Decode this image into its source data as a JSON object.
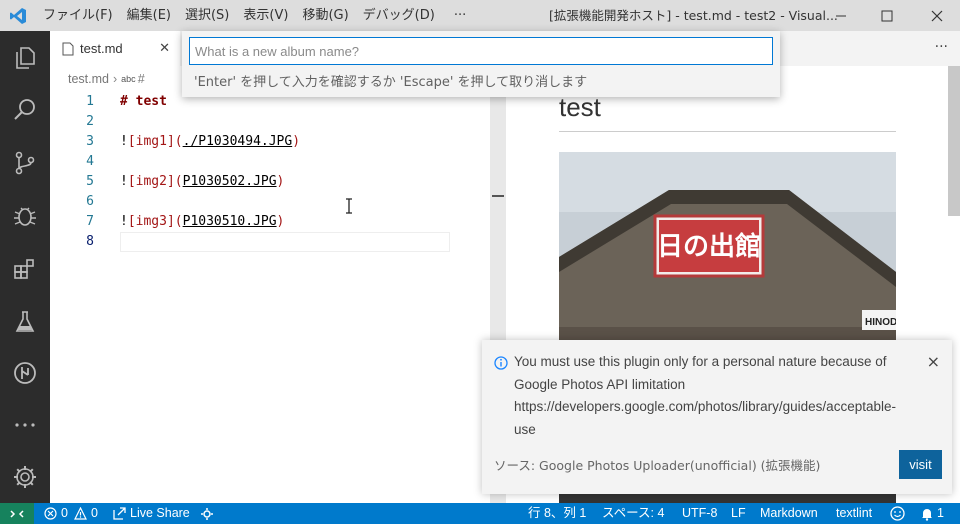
{
  "window": {
    "title": "[拡張機能開発ホスト] - test.md - test2 - Visual...",
    "menu": [
      "ファイル(F)",
      "編集(E)",
      "選択(S)",
      "表示(V)",
      "移動(G)",
      "デバッグ(D)",
      "···"
    ]
  },
  "tabs": {
    "active_label": "test.md",
    "more_actions": "···"
  },
  "breadcrumb": {
    "file": "test.md",
    "symbol_prefix": "abc",
    "symbol": "#"
  },
  "editor": {
    "lines": [
      {
        "num": "1",
        "parts": [
          {
            "t": "# test",
            "c": "heading"
          }
        ]
      },
      {
        "num": "2",
        "parts": []
      },
      {
        "num": "3",
        "parts": [
          {
            "t": "!",
            "c": "bang"
          },
          {
            "t": "[",
            "c": "brk"
          },
          {
            "t": "img1",
            "c": "alt"
          },
          {
            "t": "](",
            "c": "paren"
          },
          {
            "t": "./P1030494.JPG",
            "c": "url-txt"
          },
          {
            "t": ")",
            "c": "paren"
          }
        ]
      },
      {
        "num": "4",
        "parts": []
      },
      {
        "num": "5",
        "parts": [
          {
            "t": "!",
            "c": "bang"
          },
          {
            "t": "[",
            "c": "brk"
          },
          {
            "t": "img2",
            "c": "alt"
          },
          {
            "t": "](",
            "c": "paren"
          },
          {
            "t": "P1030502.JPG",
            "c": "url-txt"
          },
          {
            "t": ")",
            "c": "paren"
          }
        ]
      },
      {
        "num": "6",
        "parts": []
      },
      {
        "num": "7",
        "parts": [
          {
            "t": "!",
            "c": "bang"
          },
          {
            "t": "[",
            "c": "brk"
          },
          {
            "t": "img3",
            "c": "alt"
          },
          {
            "t": "](",
            "c": "paren"
          },
          {
            "t": "P1030510.JPG",
            "c": "url-txt"
          },
          {
            "t": ")",
            "c": "paren"
          }
        ]
      },
      {
        "num": "8",
        "parts": []
      }
    ],
    "current_line": 8
  },
  "preview": {
    "heading": "test",
    "sign_text": "日の出館",
    "shop_sign": "HINOD"
  },
  "quick_input": {
    "placeholder": "What is a new album name?",
    "value": "",
    "message": "'Enter' を押して入力を確認するか 'Escape' を押して取り消します"
  },
  "notification": {
    "message": "You must use this plugin only for a personal nature because of Google Photos API limitation https://developers.google.com/photos/library/guides/acceptable-use",
    "source": "ソース: Google Photos Uploader(unofficial) (拡張機能)",
    "button": "visit",
    "close": "×"
  },
  "statusbar": {
    "errors": "0",
    "warnings": "0",
    "live_share": "Live Share",
    "position": "行 8、列 1",
    "spaces": "スペース: 4",
    "encoding": "UTF-8",
    "eol": "LF",
    "language": "Markdown",
    "linter": "textlint",
    "notifications": "1"
  },
  "colors": {
    "accent": "#007acc",
    "remote": "#16825d",
    "activitybar": "#2c2c2c",
    "button": "#0e639c"
  }
}
